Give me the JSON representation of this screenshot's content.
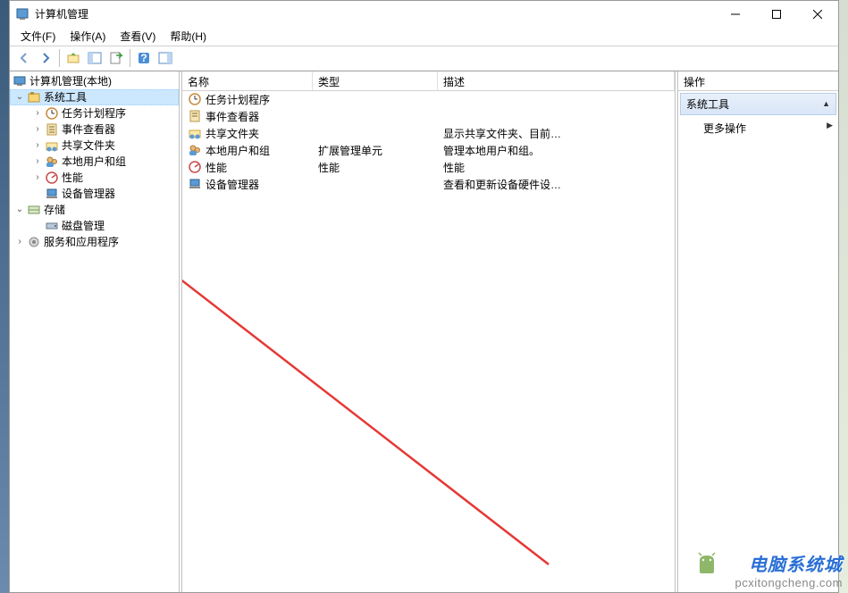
{
  "window": {
    "title": "计算机管理"
  },
  "menu": {
    "file": "文件(F)",
    "action": "操作(A)",
    "view": "查看(V)",
    "help": "帮助(H)"
  },
  "tree": {
    "root": "计算机管理(本地)",
    "system_tools": "系统工具",
    "task_scheduler": "任务计划程序",
    "event_viewer": "事件查看器",
    "shared_folders": "共享文件夹",
    "local_users": "本地用户和组",
    "performance": "性能",
    "device_manager": "设备管理器",
    "storage": "存储",
    "disk_mgmt": "磁盘管理",
    "services_apps": "服务和应用程序"
  },
  "list": {
    "headers": {
      "name": "名称",
      "type": "类型",
      "desc": "描述"
    },
    "rows": [
      {
        "name_key": "task_scheduler",
        "type": "",
        "desc": ""
      },
      {
        "name_key": "event_viewer",
        "type": "",
        "desc": ""
      },
      {
        "name_key": "shared_folders",
        "type": "",
        "desc": "显示共享文件夹、目前…"
      },
      {
        "name_key": "local_users",
        "type": "扩展管理单元",
        "desc": "管理本地用户和组。"
      },
      {
        "name_key": "performance",
        "type": "性能",
        "desc": "性能"
      },
      {
        "name_key": "device_manager",
        "type": "",
        "desc": "查看和更新设备硬件设…"
      }
    ]
  },
  "actions": {
    "header": "操作",
    "section": "系统工具",
    "more": "更多操作"
  },
  "watermark": {
    "line1": "电脑系统城",
    "line2": "pcxitongcheng.com"
  }
}
